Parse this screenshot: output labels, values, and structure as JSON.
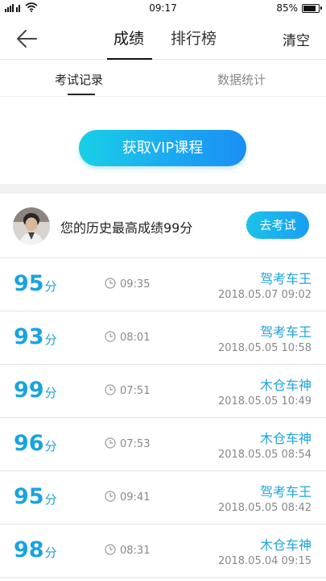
{
  "status_bar": {
    "signal_text": "¿ıll",
    "time": "09:17",
    "battery_percent": "85%",
    "battery_level": 0.85
  },
  "nav": {
    "tabs": [
      {
        "label": "成绩",
        "active": true
      },
      {
        "label": "排行榜",
        "active": false
      }
    ],
    "clear_label": "清空"
  },
  "sub_tabs": [
    {
      "label": "考试记录",
      "active": true
    },
    {
      "label": "数据统计",
      "active": false
    }
  ],
  "vip": {
    "button_label": "获取VIP课程"
  },
  "profile": {
    "best_score_text": "您的历史最高成绩99分",
    "exam_button_label": "去考试"
  },
  "records": [
    {
      "score": "95",
      "unit": "分",
      "duration": "09:35",
      "title": "驾考车王",
      "date": "2018.05.07  09:02"
    },
    {
      "score": "93",
      "unit": "分",
      "duration": "08:01",
      "title": "驾考车王",
      "date": "2018.05.05  10:58"
    },
    {
      "score": "99",
      "unit": "分",
      "duration": "07:51",
      "title": "木仓车神",
      "date": "2018.05.05  10:49"
    },
    {
      "score": "96",
      "unit": "分",
      "duration": "07:53",
      "title": "木仓车神",
      "date": "2018.05.05  08:54"
    },
    {
      "score": "95",
      "unit": "分",
      "duration": "09:41",
      "title": "驾考车王",
      "date": "2018.05.05  08:42"
    },
    {
      "score": "98",
      "unit": "分",
      "duration": "08:31",
      "title": "木仓车神",
      "date": "2018.05.04  09:15"
    }
  ],
  "colors": {
    "accent": "#1aa3df",
    "vip_gradient_start": "#19cfe6",
    "vip_gradient_end": "#1a8ff4"
  },
  "icons": {
    "back": "arrow-left-icon",
    "clock": "clock-icon",
    "wifi": "wifi-icon",
    "signal": "signal-icon",
    "battery": "battery-icon"
  }
}
